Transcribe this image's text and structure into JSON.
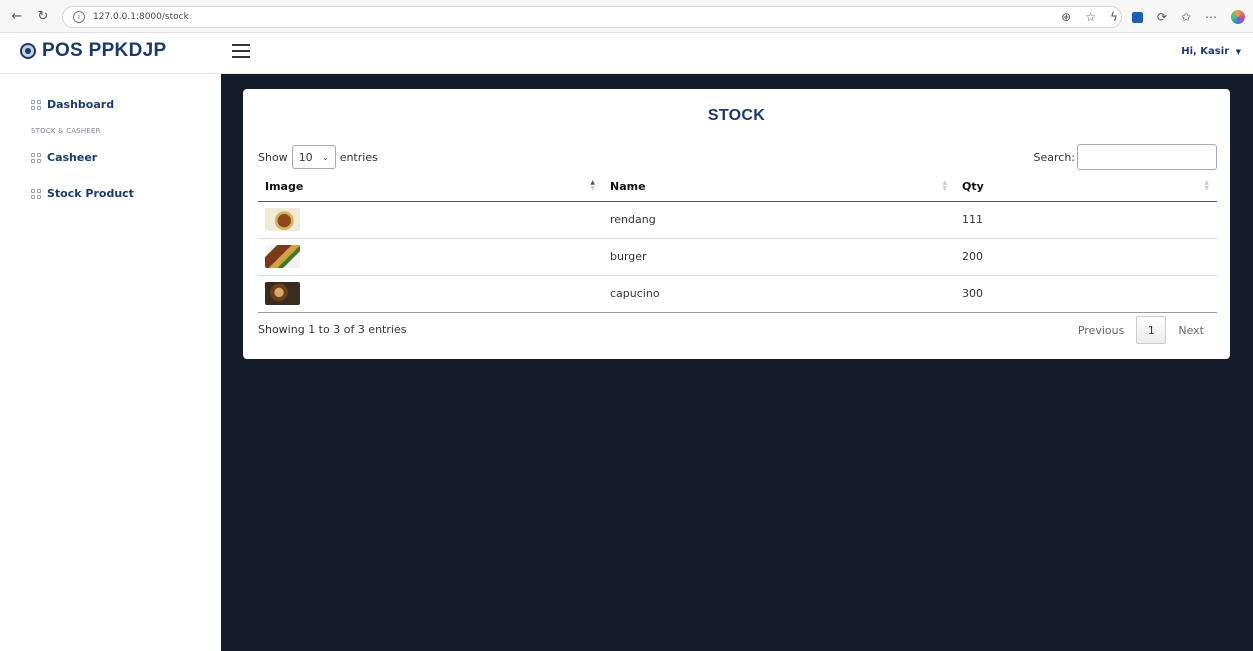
{
  "browser": {
    "url": "127.0.0.1:8000/stock"
  },
  "header": {
    "brand": "POS PPKDJP",
    "user_greeting": "Hi, Kasir"
  },
  "sidebar": {
    "items": [
      {
        "label": "Dashboard"
      },
      {
        "label": "Casheer"
      },
      {
        "label": "Stock Product"
      }
    ],
    "section_heading": "STOCK & CASHEER"
  },
  "card": {
    "title": "STOCK",
    "show_label": "Show",
    "entries_label": "entries",
    "page_length": "10",
    "search_label": "Search:",
    "search_value": ""
  },
  "table": {
    "columns": [
      "Image",
      "Name",
      "Qty"
    ],
    "rows": [
      {
        "image": "rendang-thumb",
        "name": "rendang",
        "qty": "111"
      },
      {
        "image": "burger-thumb",
        "name": "burger",
        "qty": "200"
      },
      {
        "image": "capucino-thumb",
        "name": "capucino",
        "qty": "300"
      }
    ]
  },
  "footer": {
    "info": "Showing 1 to 3 of 3 entries",
    "previous": "Previous",
    "page": "1",
    "next": "Next"
  },
  "colors": {
    "brand": "#1b3a6b",
    "main_bg": "#141c29"
  }
}
